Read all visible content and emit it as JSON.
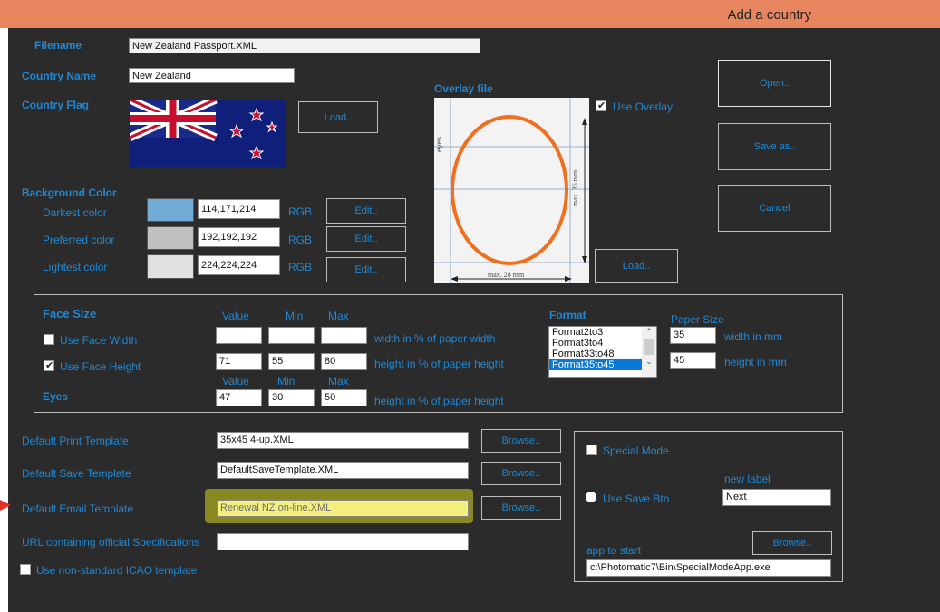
{
  "window": {
    "title": "Add a country"
  },
  "labels": {
    "filename": "Filename",
    "country_name": "Country Name",
    "country_flag": "Country Flag",
    "overlay_file": "Overlay file",
    "background_color": "Background Color",
    "darkest": "Darkest color",
    "preferred": "Preferred color",
    "lightest": "Lightest color",
    "rgb": "RGB"
  },
  "fields": {
    "filename": "New Zealand Passport.XML",
    "country_name": "New Zealand",
    "darkest_rgb": "114,171,214",
    "preferred_rgb": "192,192,192",
    "lightest_rgb": "224,224,224"
  },
  "colors": {
    "darkest": "#72abd6",
    "preferred": "#c0c0c0",
    "lightest": "#e0e0e0",
    "accent": "#1e88d6",
    "overlay_ellipse": "#f07020",
    "highlight": "#f4f080"
  },
  "buttons": {
    "load_flag": "Load..",
    "load_overlay": "Load..",
    "edit": "Edit..",
    "open": "Open..",
    "save_as": "Save as..",
    "cancel": "Cancel",
    "browse": "Browse.."
  },
  "overlay": {
    "use_overlay": "Use Overlay",
    "use_overlay_checked": true,
    "eyes": "eyes",
    "max_height": "max. 36 mm",
    "max_width": "max. 28 mm"
  },
  "face": {
    "title": "Face Size",
    "col_value": "Value",
    "col_min": "Min",
    "col_max": "Max",
    "use_width": "Use Face Width",
    "use_width_checked": false,
    "use_height": "Use Face Height",
    "use_height_checked": true,
    "width_hint": "width in % of paper width",
    "height_hint": "height in % of paper height",
    "width_value": "",
    "width_min": "",
    "width_max": "",
    "height_value": "71",
    "height_min": "55",
    "height_max": "80",
    "eyes_label": "Eyes",
    "eyes_value": "47",
    "eyes_min": "30",
    "eyes_max": "50",
    "eyes_hint": "height in % of paper height"
  },
  "format": {
    "label": "Format",
    "options": [
      "Format2to3",
      "Format3to4",
      "Format33to48",
      "Format35to45"
    ],
    "selected": "Format35to45",
    "paper_size": "Paper Size",
    "width_mm": "35",
    "height_mm": "45",
    "width_hint": "width in mm",
    "height_hint": "height in mm"
  },
  "templates": {
    "print_label": "Default Print Template",
    "print_value": "35x45 4-up.XML",
    "save_label": "Default Save Template",
    "save_value": "DefaultSaveTemplate.XML",
    "email_label": "Default Email Template",
    "email_value": "Renewal NZ on-line.XML",
    "url_label": "URL containing official Specifications",
    "url_value": "",
    "icao_label": "Use non-standard ICAO template"
  },
  "special": {
    "mode_label": "Special Mode",
    "new_label_title": "new label",
    "use_save_btn": "Use Save Btn",
    "new_label_value": "Next",
    "app_to_start": "app to start",
    "app_path": "c:\\Photomatic7\\Bin\\SpecialModeApp.exe"
  }
}
